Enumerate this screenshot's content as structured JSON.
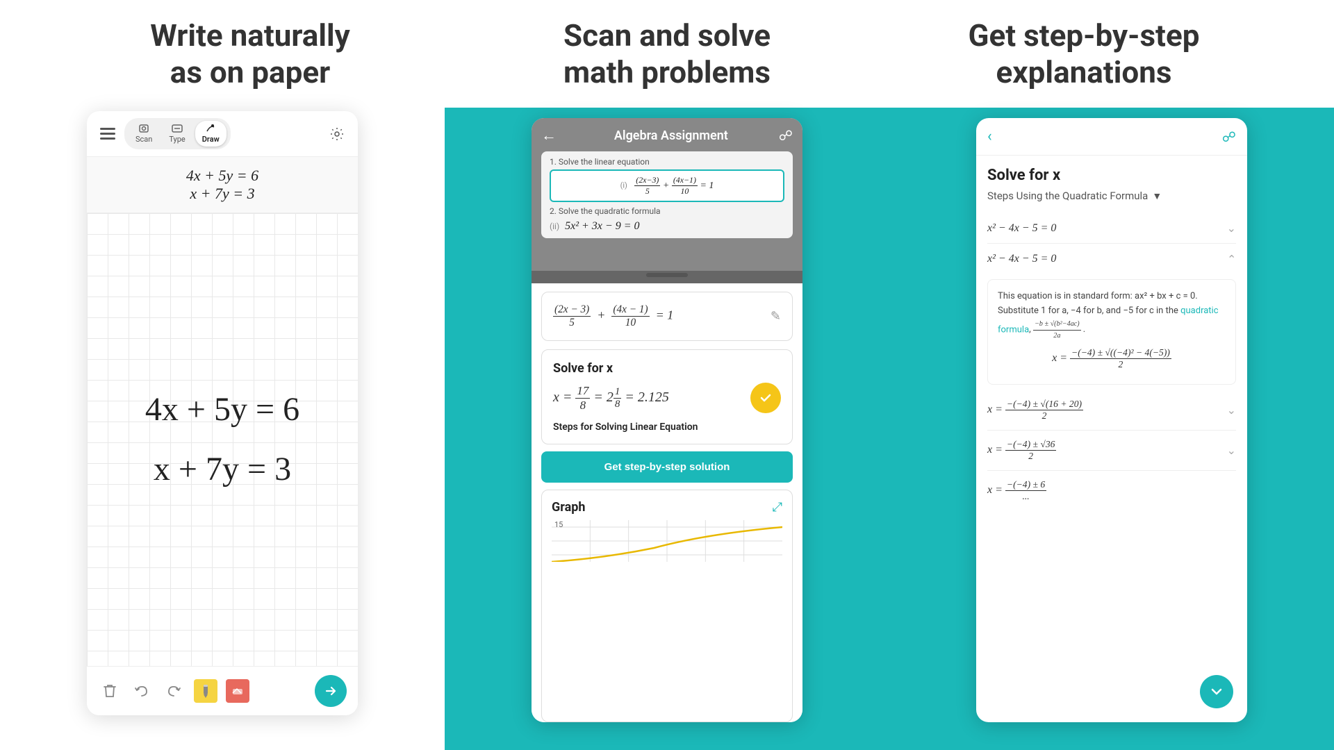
{
  "header": {
    "col1_title": "Write naturally\nas on paper",
    "col2_title": "Scan and solve\nmath problems",
    "col3_title": "Get step-by-step\nexplanations"
  },
  "col1": {
    "typed_eq1": "4x + 5y = 6",
    "typed_eq2": "x + 7y = 3",
    "handwritten_eq1": "4x + 5y = 6",
    "handwritten_eq2": "x + 7y = 3",
    "toolbar": {
      "scan_label": "Scan",
      "type_label": "Type",
      "draw_label": "Draw"
    },
    "bottom_bar": {
      "submit_label": "→"
    }
  },
  "col2": {
    "assignment_title": "Algebra Assignment",
    "problem1_label": "1. Solve the linear equation",
    "problem1_eq": "(2x-3)/5 + (4x-1)/10 = 1",
    "problem2_label": "2. Solve the quadratic formula",
    "problem2_eq": "5x² + 3x - 9 = 0",
    "result_eq": "(2x − 3)/5 + (4x − 1)/10 = 1",
    "solve_title": "Solve for x",
    "solve_result": "x = 17/8 = 2⅛ = 2.125",
    "steps_label": "Steps for Solving Linear Equation",
    "step_btn_label": "Get step-by-step solution",
    "graph_title": "Graph",
    "graph_expand": "⤢",
    "graph_y_label": "15"
  },
  "col3": {
    "solve_title": "Solve for x",
    "method_label": "Steps Using the Quadratic Formula",
    "eq1": "x² − 4x − 5 = 0",
    "eq2": "x² − 4x − 5 = 0",
    "expanded_text1": "This equation is in standard form: ax² + bx + c = 0. Substitute 1 for a, −4 for b, and −5 for c in the ",
    "expanded_link": "quadratic formula",
    "expanded_text2": ", (−b ± √(b²−4ac)) / 2a.",
    "big_eq1": "x = (−(−4) ± √((−4)² − 4(−5))) / 2",
    "eq3": "x = (−(−4) ± √(16 + 20)) / 2",
    "eq4": "x = (−(−4) ± √36) / 2",
    "eq5": "x = (−(−4) ± 6) / ...",
    "scroll_down_label": "↓"
  }
}
